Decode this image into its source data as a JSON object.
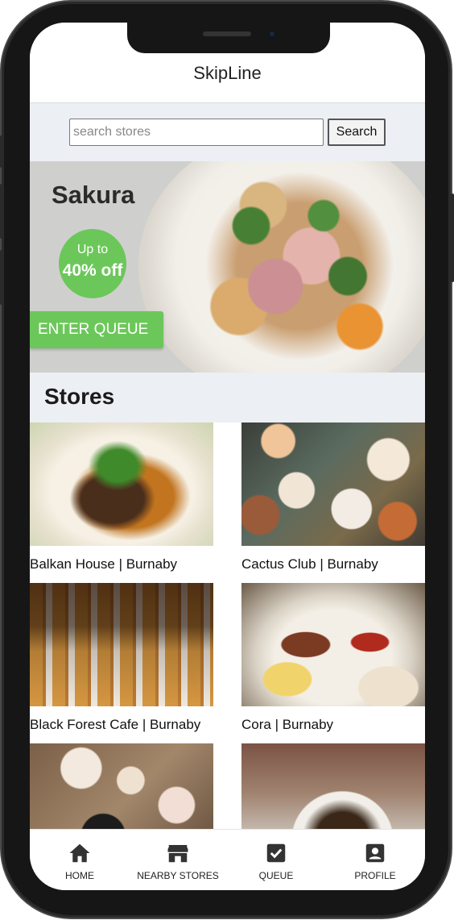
{
  "header": {
    "title": "SkipLine"
  },
  "search": {
    "placeholder": "search stores",
    "value": "",
    "button_label": "Search"
  },
  "banner": {
    "store_name": "Sakura",
    "promo_prefix": "Up to",
    "promo_value": "40% off",
    "queue_button_label": "ENTER QUEUE"
  },
  "stores": {
    "heading": "Stores",
    "items": [
      {
        "name": "Balkan House | Burnaby"
      },
      {
        "name": "Cactus Club | Burnaby"
      },
      {
        "name": "Black Forest Cafe | Burnaby"
      },
      {
        "name": "Cora | Burnaby"
      },
      {
        "name": ""
      },
      {
        "name": ""
      }
    ]
  },
  "tabs": [
    {
      "label": "HOME",
      "icon": "home-icon"
    },
    {
      "label": "NEARBY STORES",
      "icon": "store-icon"
    },
    {
      "label": "QUEUE",
      "icon": "checkbox-icon"
    },
    {
      "label": "PROFILE",
      "icon": "profile-icon"
    }
  ],
  "colors": {
    "accent_green": "#6cc75a",
    "section_bg": "#eceff3"
  }
}
